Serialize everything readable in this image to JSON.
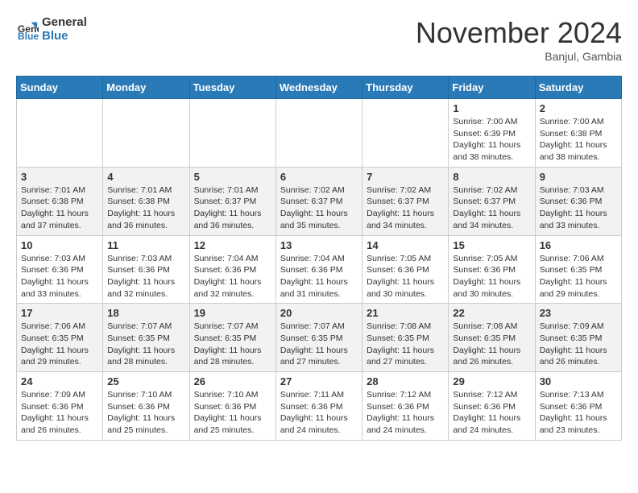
{
  "header": {
    "logo": {
      "line1": "General",
      "line2": "Blue"
    },
    "title": "November 2024",
    "location": "Banjul, Gambia"
  },
  "weekdays": [
    "Sunday",
    "Monday",
    "Tuesday",
    "Wednesday",
    "Thursday",
    "Friday",
    "Saturday"
  ],
  "weeks": [
    [
      {
        "day": "",
        "info": ""
      },
      {
        "day": "",
        "info": ""
      },
      {
        "day": "",
        "info": ""
      },
      {
        "day": "",
        "info": ""
      },
      {
        "day": "",
        "info": ""
      },
      {
        "day": "1",
        "info": "Sunrise: 7:00 AM\nSunset: 6:39 PM\nDaylight: 11 hours and 38 minutes."
      },
      {
        "day": "2",
        "info": "Sunrise: 7:00 AM\nSunset: 6:38 PM\nDaylight: 11 hours and 38 minutes."
      }
    ],
    [
      {
        "day": "3",
        "info": "Sunrise: 7:01 AM\nSunset: 6:38 PM\nDaylight: 11 hours and 37 minutes."
      },
      {
        "day": "4",
        "info": "Sunrise: 7:01 AM\nSunset: 6:38 PM\nDaylight: 11 hours and 36 minutes."
      },
      {
        "day": "5",
        "info": "Sunrise: 7:01 AM\nSunset: 6:37 PM\nDaylight: 11 hours and 36 minutes."
      },
      {
        "day": "6",
        "info": "Sunrise: 7:02 AM\nSunset: 6:37 PM\nDaylight: 11 hours and 35 minutes."
      },
      {
        "day": "7",
        "info": "Sunrise: 7:02 AM\nSunset: 6:37 PM\nDaylight: 11 hours and 34 minutes."
      },
      {
        "day": "8",
        "info": "Sunrise: 7:02 AM\nSunset: 6:37 PM\nDaylight: 11 hours and 34 minutes."
      },
      {
        "day": "9",
        "info": "Sunrise: 7:03 AM\nSunset: 6:36 PM\nDaylight: 11 hours and 33 minutes."
      }
    ],
    [
      {
        "day": "10",
        "info": "Sunrise: 7:03 AM\nSunset: 6:36 PM\nDaylight: 11 hours and 33 minutes."
      },
      {
        "day": "11",
        "info": "Sunrise: 7:03 AM\nSunset: 6:36 PM\nDaylight: 11 hours and 32 minutes."
      },
      {
        "day": "12",
        "info": "Sunrise: 7:04 AM\nSunset: 6:36 PM\nDaylight: 11 hours and 32 minutes."
      },
      {
        "day": "13",
        "info": "Sunrise: 7:04 AM\nSunset: 6:36 PM\nDaylight: 11 hours and 31 minutes."
      },
      {
        "day": "14",
        "info": "Sunrise: 7:05 AM\nSunset: 6:36 PM\nDaylight: 11 hours and 30 minutes."
      },
      {
        "day": "15",
        "info": "Sunrise: 7:05 AM\nSunset: 6:36 PM\nDaylight: 11 hours and 30 minutes."
      },
      {
        "day": "16",
        "info": "Sunrise: 7:06 AM\nSunset: 6:35 PM\nDaylight: 11 hours and 29 minutes."
      }
    ],
    [
      {
        "day": "17",
        "info": "Sunrise: 7:06 AM\nSunset: 6:35 PM\nDaylight: 11 hours and 29 minutes."
      },
      {
        "day": "18",
        "info": "Sunrise: 7:07 AM\nSunset: 6:35 PM\nDaylight: 11 hours and 28 minutes."
      },
      {
        "day": "19",
        "info": "Sunrise: 7:07 AM\nSunset: 6:35 PM\nDaylight: 11 hours and 28 minutes."
      },
      {
        "day": "20",
        "info": "Sunrise: 7:07 AM\nSunset: 6:35 PM\nDaylight: 11 hours and 27 minutes."
      },
      {
        "day": "21",
        "info": "Sunrise: 7:08 AM\nSunset: 6:35 PM\nDaylight: 11 hours and 27 minutes."
      },
      {
        "day": "22",
        "info": "Sunrise: 7:08 AM\nSunset: 6:35 PM\nDaylight: 11 hours and 26 minutes."
      },
      {
        "day": "23",
        "info": "Sunrise: 7:09 AM\nSunset: 6:35 PM\nDaylight: 11 hours and 26 minutes."
      }
    ],
    [
      {
        "day": "24",
        "info": "Sunrise: 7:09 AM\nSunset: 6:36 PM\nDaylight: 11 hours and 26 minutes."
      },
      {
        "day": "25",
        "info": "Sunrise: 7:10 AM\nSunset: 6:36 PM\nDaylight: 11 hours and 25 minutes."
      },
      {
        "day": "26",
        "info": "Sunrise: 7:10 AM\nSunset: 6:36 PM\nDaylight: 11 hours and 25 minutes."
      },
      {
        "day": "27",
        "info": "Sunrise: 7:11 AM\nSunset: 6:36 PM\nDaylight: 11 hours and 24 minutes."
      },
      {
        "day": "28",
        "info": "Sunrise: 7:12 AM\nSunset: 6:36 PM\nDaylight: 11 hours and 24 minutes."
      },
      {
        "day": "29",
        "info": "Sunrise: 7:12 AM\nSunset: 6:36 PM\nDaylight: 11 hours and 24 minutes."
      },
      {
        "day": "30",
        "info": "Sunrise: 7:13 AM\nSunset: 6:36 PM\nDaylight: 11 hours and 23 minutes."
      }
    ]
  ]
}
